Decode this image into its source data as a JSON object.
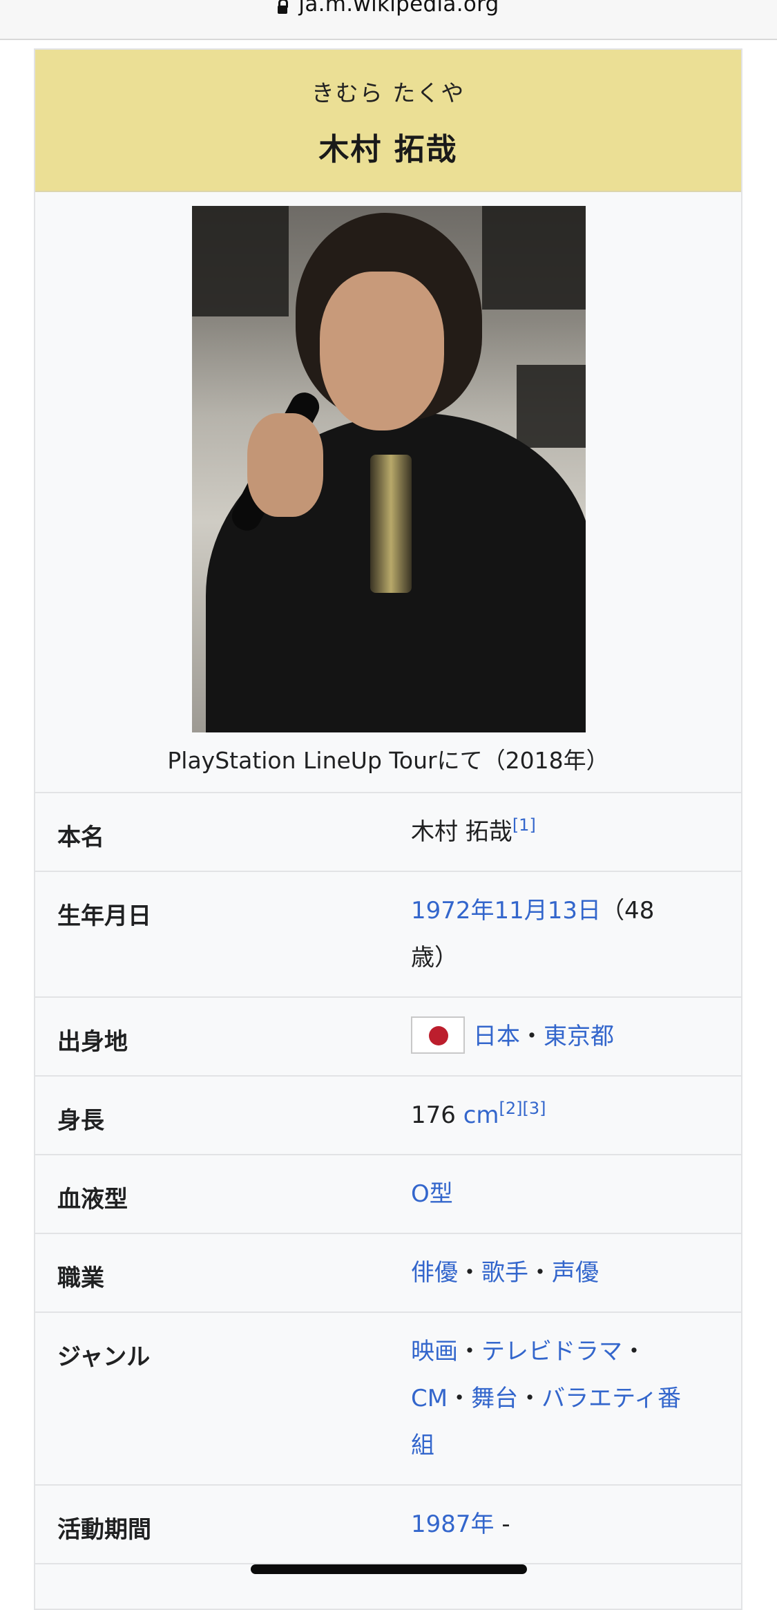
{
  "browser": {
    "url": "ja.m.wikipedia.org"
  },
  "infobox": {
    "kana": "きむら たくや",
    "name": "木村 拓哉",
    "caption": "PlayStation LineUp Tourにて（2018年）",
    "rows": {
      "real_name": {
        "label": "本名",
        "value": "木村 拓哉",
        "ref": "[1]"
      },
      "birth": {
        "label": "生年月日",
        "date_link": "1972年11月13日",
        "age_line1": "（48",
        "age_line2": "歳）"
      },
      "origin": {
        "label": "出身地",
        "country": "日本",
        "sep": "・",
        "city": "東京都"
      },
      "height": {
        "label": "身長",
        "value": "176 ",
        "unit_link": "cm",
        "refs": "[2][3]"
      },
      "blood": {
        "label": "血液型",
        "value": "O型"
      },
      "job": {
        "label": "職業",
        "items": [
          "俳優",
          "歌手",
          "声優"
        ],
        "sep": "・"
      },
      "genre": {
        "label": "ジャンル",
        "line1": [
          "映画",
          "テレビドラマ"
        ],
        "line2": [
          "CM",
          "舞台",
          "バラエティ番"
        ],
        "line3": "組",
        "sep": "・"
      },
      "active": {
        "label": "活動期間",
        "year_link": "1987年",
        "suffix": " -"
      }
    }
  },
  "colors": {
    "header_bg": "#ebdf95",
    "link": "#3366cc",
    "infobox_bg": "#f8f9fa"
  }
}
